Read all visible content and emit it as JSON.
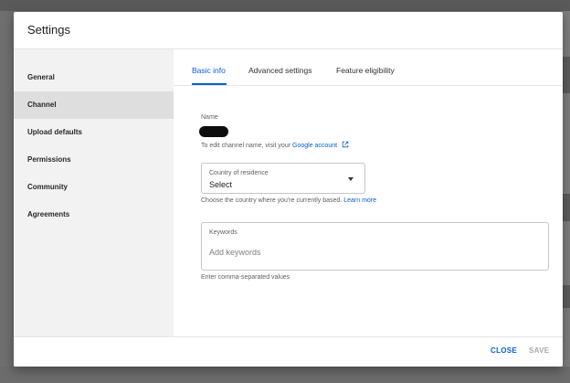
{
  "dialog": {
    "title": "Settings"
  },
  "sidebar": {
    "items": [
      {
        "label": "General"
      },
      {
        "label": "Channel"
      },
      {
        "label": "Upload defaults"
      },
      {
        "label": "Permissions"
      },
      {
        "label": "Community"
      },
      {
        "label": "Agreements"
      }
    ],
    "active": "Channel"
  },
  "tabs": [
    {
      "label": "Basic info"
    },
    {
      "label": "Advanced settings"
    },
    {
      "label": "Feature eligibility"
    }
  ],
  "basic_info": {
    "name_label": "Name",
    "edit_hint": "To edit channel name, visit your",
    "edit_link": "Google account",
    "country": {
      "label": "Country of residence",
      "value": "Select"
    },
    "country_hint": "Choose the country where you're currently based.",
    "country_link": "Learn more",
    "keywords": {
      "label": "Keywords",
      "placeholder": "Add keywords",
      "value": ""
    },
    "keywords_hint": "Enter comma-separated values"
  },
  "footer": {
    "close_label": "CLOSE",
    "save_label": "SAVE"
  },
  "colors": {
    "accent": "#065fd4",
    "disabled": "#a8a8a8",
    "sidebar_bg": "#f2f2f2",
    "sidebar_active": "#dedede"
  },
  "icons": {
    "external_link": "open-in-new-icon",
    "dropdown": "arrow-drop-down-icon"
  }
}
